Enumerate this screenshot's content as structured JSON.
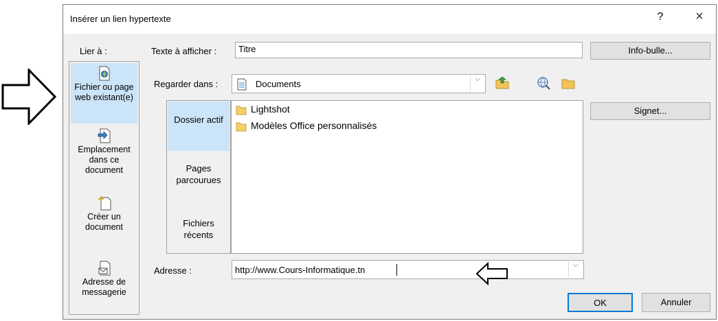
{
  "dialog": {
    "title": "Insérer un lien hypertexte",
    "help": "?",
    "close": "×"
  },
  "lier_a": {
    "label": "Lier à :",
    "items": [
      {
        "label": "Fichier ou page web existant(e)",
        "icon": "existing-file-icon",
        "active": true
      },
      {
        "label": "Emplacement dans ce document",
        "icon": "place-in-document-icon",
        "active": false
      },
      {
        "label": "Créer un document",
        "icon": "new-document-icon",
        "active": false
      },
      {
        "label": "Adresse de messagerie",
        "icon": "email-address-icon",
        "active": false
      }
    ]
  },
  "texte_afficher": {
    "label": "Texte à afficher :",
    "value": "Titre"
  },
  "info_bulle_button": "Info-bulle...",
  "regarder_dans": {
    "label": "Regarder dans :",
    "value": "Documents"
  },
  "places": [
    {
      "label": "Dossier actif",
      "active": true
    },
    {
      "label": "Pages parcourues",
      "active": false
    },
    {
      "label": "Fichiers récents",
      "active": false
    }
  ],
  "files": [
    {
      "name": "Lightshot"
    },
    {
      "name": "Modèles Office personnalisés"
    }
  ],
  "signet_button": "Signet...",
  "adresse": {
    "label": "Adresse :",
    "value": "http://www.Cours-Informatique.tn"
  },
  "ok_button": "OK",
  "cancel_button": "Annuler",
  "colors": {
    "selection": "#cce4f7",
    "ok_border": "#0078d7"
  }
}
